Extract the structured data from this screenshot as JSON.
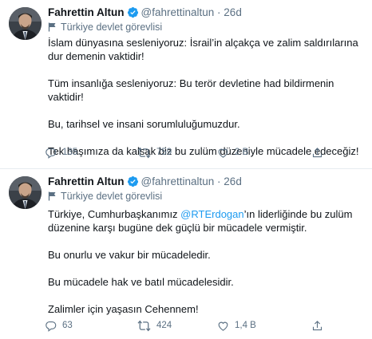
{
  "tweets": [
    {
      "author_name": "Fahrettin Altun",
      "handle": "@fahrettinaltun",
      "time": "26d",
      "separator": "·",
      "account_label": "Türkiye devlet görevlisi",
      "paragraphs": [
        "İslam dünyasına sesleniyoruz: İsrail’in alçakça ve zalim saldırılarına dur demenin vaktidir!",
        "Tüm insanlığa sesleniyoruz: Bu terör devletine had bildirmenin vaktidir!",
        "Bu, tarihsel ve insani sorumluluğumuzdur.",
        "Tek başımıza da kalsak biz bu zulüm düzeniyle mücadele edeceğiz!"
      ],
      "replies": "135",
      "retweets": "759",
      "likes": "2 B"
    },
    {
      "author_name": "Fahrettin Altun",
      "handle": "@fahrettinaltun",
      "time": "26d",
      "separator": "·",
      "account_label": "Türkiye devlet görevlisi",
      "intro_before": "Türkiye, Cumhurbaşkanımız ",
      "mention": "@RTErdogan",
      "intro_after": "’ın liderliğinde bu zulüm düzenine karşı bugüne dek güçlü bir mücadele vermiştir.",
      "paragraphs": [
        "Bu onurlu ve vakur bir mücadeledir.",
        "Bu mücadele hak ve batıl mücadelesidir.",
        "Zalimler için yaşasın Cehennem!"
      ],
      "replies": "63",
      "retweets": "424",
      "likes": "1,4 B"
    }
  ],
  "colors": {
    "verified_badge": "#1d9bf0",
    "mention": "#1d9bf0",
    "muted_text": "#5b7083",
    "divider": "#e6ecf0"
  },
  "icons": [
    "verified-badge-icon",
    "flag-icon",
    "reply-icon",
    "retweet-icon",
    "like-icon",
    "share-icon"
  ]
}
